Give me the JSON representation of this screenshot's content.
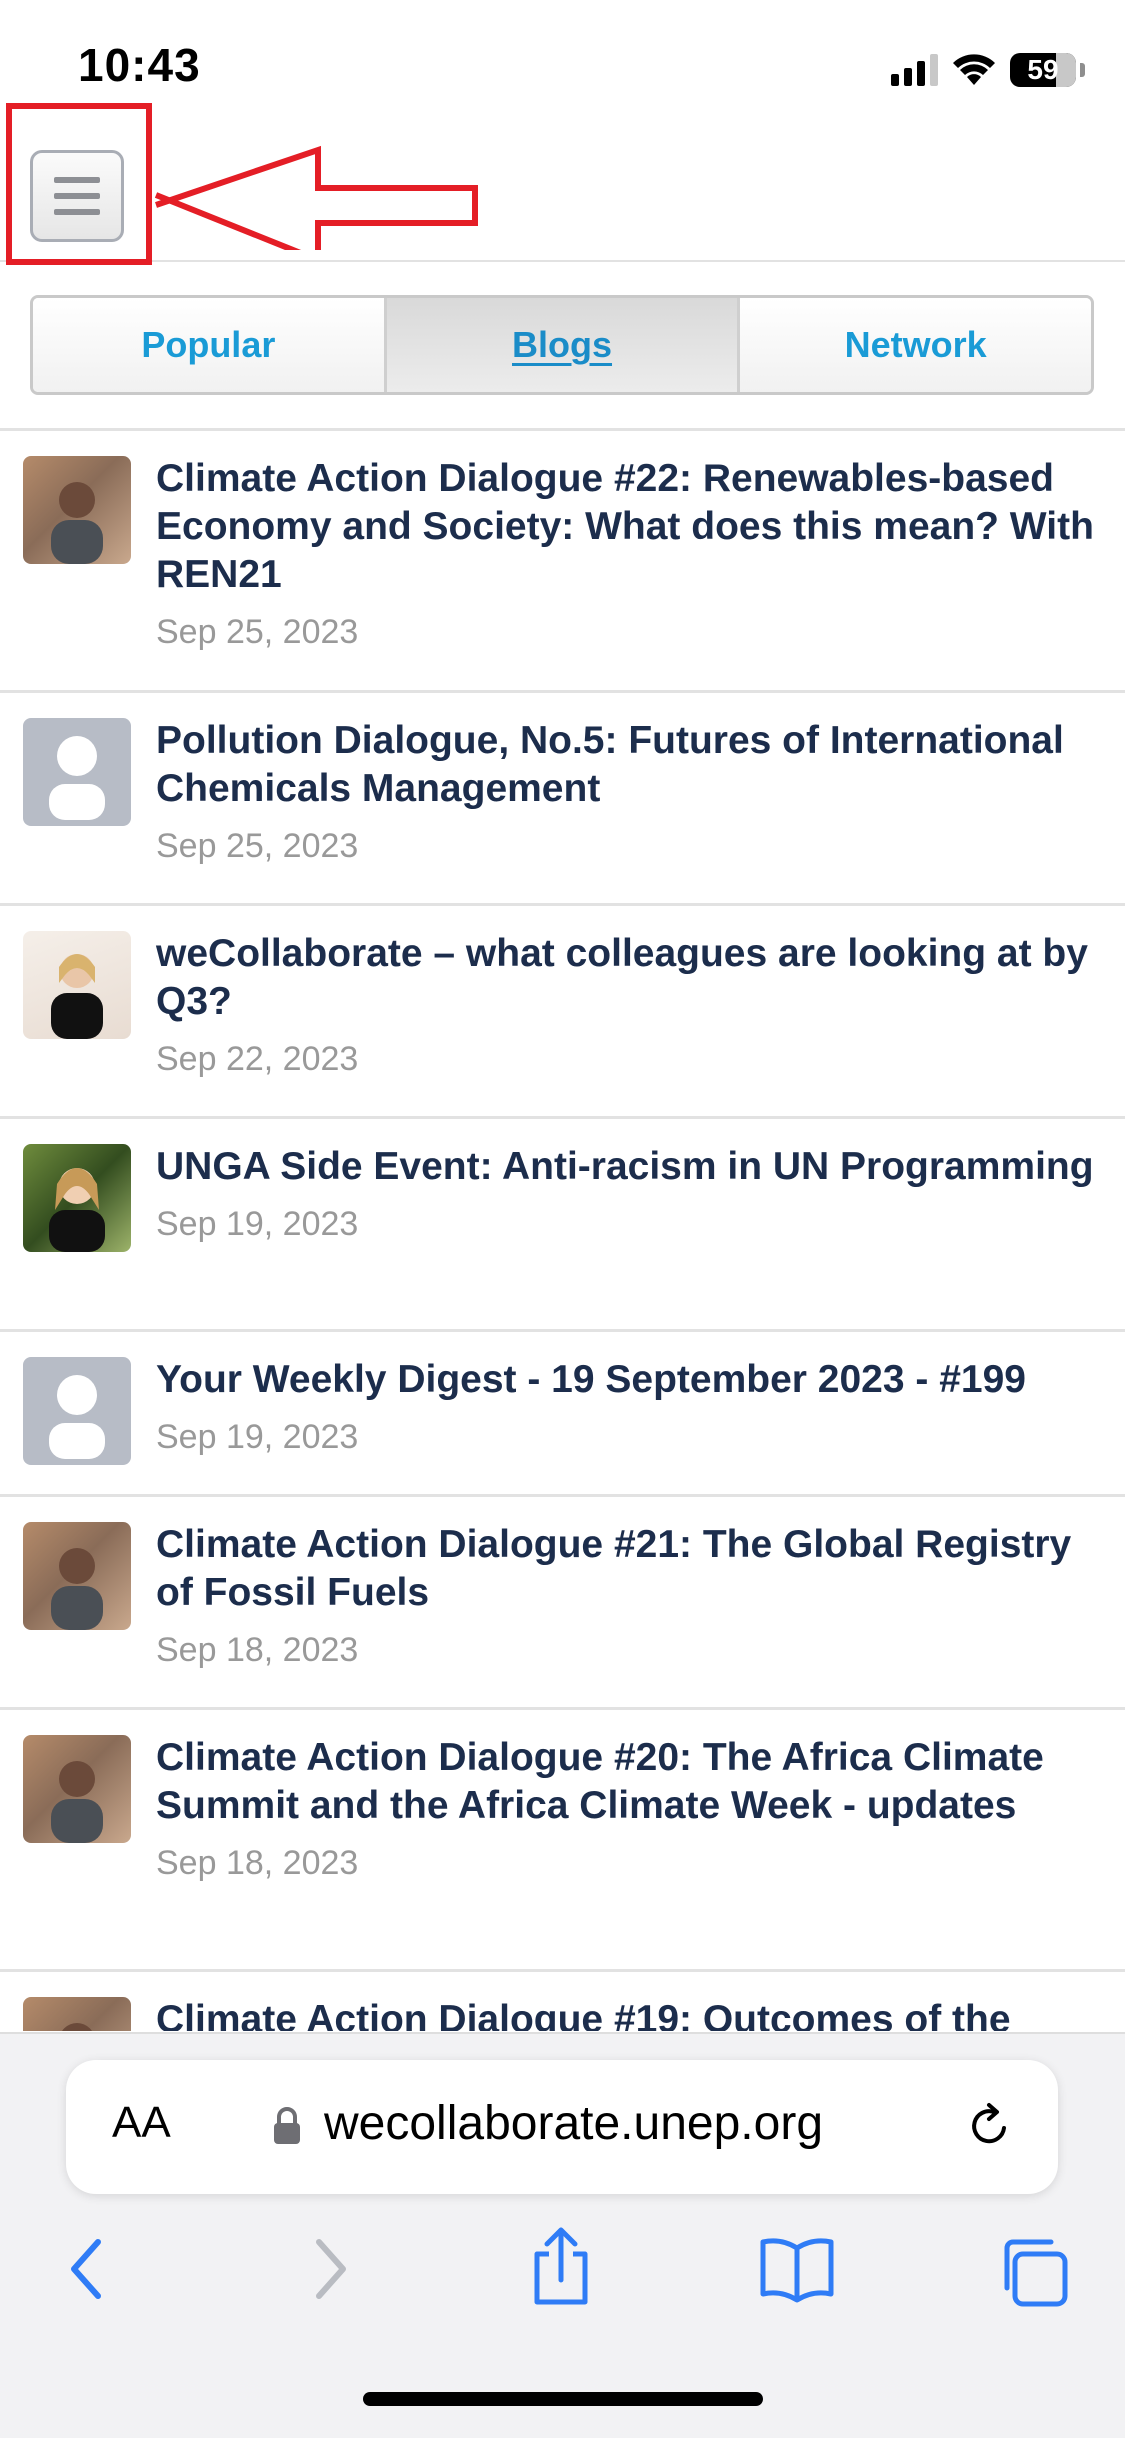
{
  "status_bar": {
    "time": "10:43",
    "battery": "59"
  },
  "header": {
    "menu_label": "Menu"
  },
  "tabs": [
    {
      "label": "Popular",
      "active": false
    },
    {
      "label": "Blogs",
      "active": true
    },
    {
      "label": "Network",
      "active": false
    }
  ],
  "posts": [
    {
      "title": "Climate Action Dialogue #22: Renewables-based Economy and Society: What does this mean? With REN21",
      "date": "Sep 25, 2023",
      "avatar": "photo"
    },
    {
      "title": "Pollution Dialogue, No.5: Futures of International Chemicals Management",
      "date": "Sep 25, 2023",
      "avatar": "placeholder"
    },
    {
      "title": "weCollaborate – what colleagues are looking at by Q3?",
      "date": "Sep 22, 2023",
      "avatar": "photo"
    },
    {
      "title": "UNGA Side Event: Anti-racism in UN Programming",
      "date": "Sep 19, 2023",
      "avatar": "photo"
    },
    {
      "title": "Your Weekly Digest - 19 September 2023 - #199",
      "date": "Sep 19, 2023",
      "avatar": "placeholder"
    },
    {
      "title": "Climate Action Dialogue #21: The Global Registry of Fossil Fuels",
      "date": "Sep 18, 2023",
      "avatar": "photo"
    },
    {
      "title": "Climate Action Dialogue #20: The Africa Climate Summit and the Africa Climate Week - updates",
      "date": "Sep 18, 2023",
      "avatar": "photo"
    },
    {
      "title": "Climate Action Dialogue #19: Outcomes of the",
      "date": "",
      "avatar": "photo"
    }
  ],
  "browser": {
    "aa_label": "AA",
    "url": "wecollaborate.unep.org"
  },
  "colors": {
    "accent": "#1a9bd6",
    "title_text": "#1c2d4c",
    "annotation": "#e41e26",
    "ios_blue": "#2f7cf6"
  }
}
